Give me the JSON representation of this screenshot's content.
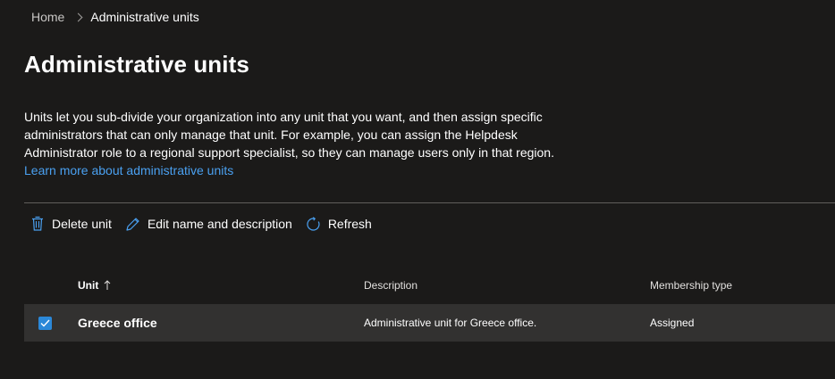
{
  "breadcrumb": {
    "home": "Home",
    "current": "Administrative units"
  },
  "page": {
    "title": "Administrative units",
    "intro_text": "Units let you sub-divide your organization into any unit that you want, and then assign specific administrators that can only manage that unit. For example, you can assign the Helpdesk Administrator role to a regional support specialist, so they can manage users only in that region.",
    "learn_more_link": "Learn more about administrative units"
  },
  "toolbar": {
    "delete_label": "Delete unit",
    "edit_label": "Edit name and description",
    "refresh_label": "Refresh",
    "icons": [
      "trash-icon",
      "pencil-icon",
      "refresh-icon"
    ]
  },
  "table": {
    "columns": {
      "unit": "Unit",
      "description": "Description",
      "membership": "Membership type"
    },
    "sort": {
      "column": "unit",
      "direction": "ascending"
    },
    "rows": [
      {
        "selected": true,
        "unit": "Greece office",
        "description": "Administrative unit for Greece office.",
        "membership": "Assigned"
      }
    ]
  },
  "colors": {
    "background": "#1b1a19",
    "accent": "#2b88d8",
    "link": "#4aa0f0",
    "selected_row": "#323130"
  }
}
